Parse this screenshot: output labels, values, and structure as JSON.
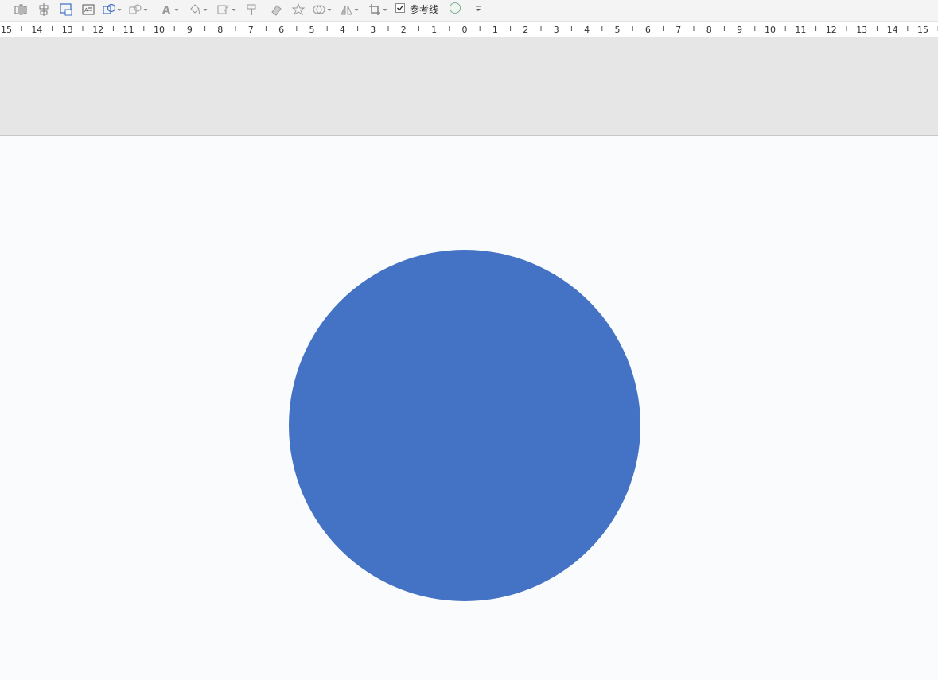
{
  "toolbar": {
    "tools": [
      {
        "name": "align-tool",
        "icon": "align-distribute-icon",
        "dropdown": false
      },
      {
        "name": "align-center-tool",
        "icon": "align-center-icon",
        "dropdown": false
      },
      {
        "name": "screen-tool",
        "icon": "screen-icon",
        "dropdown": false
      },
      {
        "name": "textbox-tool",
        "icon": "textbox-icon",
        "dropdown": false
      },
      {
        "name": "shape-tool",
        "icon": "shape-icon",
        "dropdown": true
      },
      {
        "name": "edit-shape-tool",
        "icon": "edit-shape-icon",
        "dropdown": true
      },
      {
        "name": "font-color-tool",
        "icon": "font-color-icon",
        "dropdown": true
      },
      {
        "name": "fill-tool",
        "icon": "paint-bucket-icon",
        "dropdown": true
      },
      {
        "name": "outline-tool",
        "icon": "pen-outline-icon",
        "dropdown": true
      },
      {
        "name": "format-painter-tool",
        "icon": "format-painter-icon",
        "dropdown": false
      },
      {
        "name": "eraser-tool",
        "icon": "eraser-icon",
        "dropdown": false
      },
      {
        "name": "effects-tool",
        "icon": "effects-icon",
        "dropdown": false
      },
      {
        "name": "combine-shapes-tool",
        "icon": "merge-shapes-icon",
        "dropdown": true
      },
      {
        "name": "rotate-tool",
        "icon": "rotate-flip-icon",
        "dropdown": true
      },
      {
        "name": "crop-tool",
        "icon": "crop-icon",
        "dropdown": true
      }
    ],
    "guides_checkbox": {
      "label": "参考线",
      "checked": true
    },
    "shape_indicator_icon": "circle-outline-icon",
    "overflow_icon": "chevron-down-icon"
  },
  "ruler": {
    "unit": "cm",
    "labels": [
      "15",
      "14",
      "13",
      "12",
      "11",
      "10",
      "9",
      "8",
      "7",
      "6",
      "5",
      "4",
      "3",
      "2",
      "1",
      "0",
      "1",
      "2",
      "3",
      "4",
      "5",
      "6",
      "7",
      "8",
      "9",
      "10",
      "11",
      "12",
      "13",
      "14",
      "15"
    ]
  },
  "canvas": {
    "shape": {
      "type": "circle",
      "fill": "#4472c4"
    },
    "guides": {
      "vertical": true,
      "horizontal": true,
      "color": "#9a9a9a"
    },
    "pasteboard_color": "#e6e6e6",
    "slide_color": "#f9fbfc"
  }
}
